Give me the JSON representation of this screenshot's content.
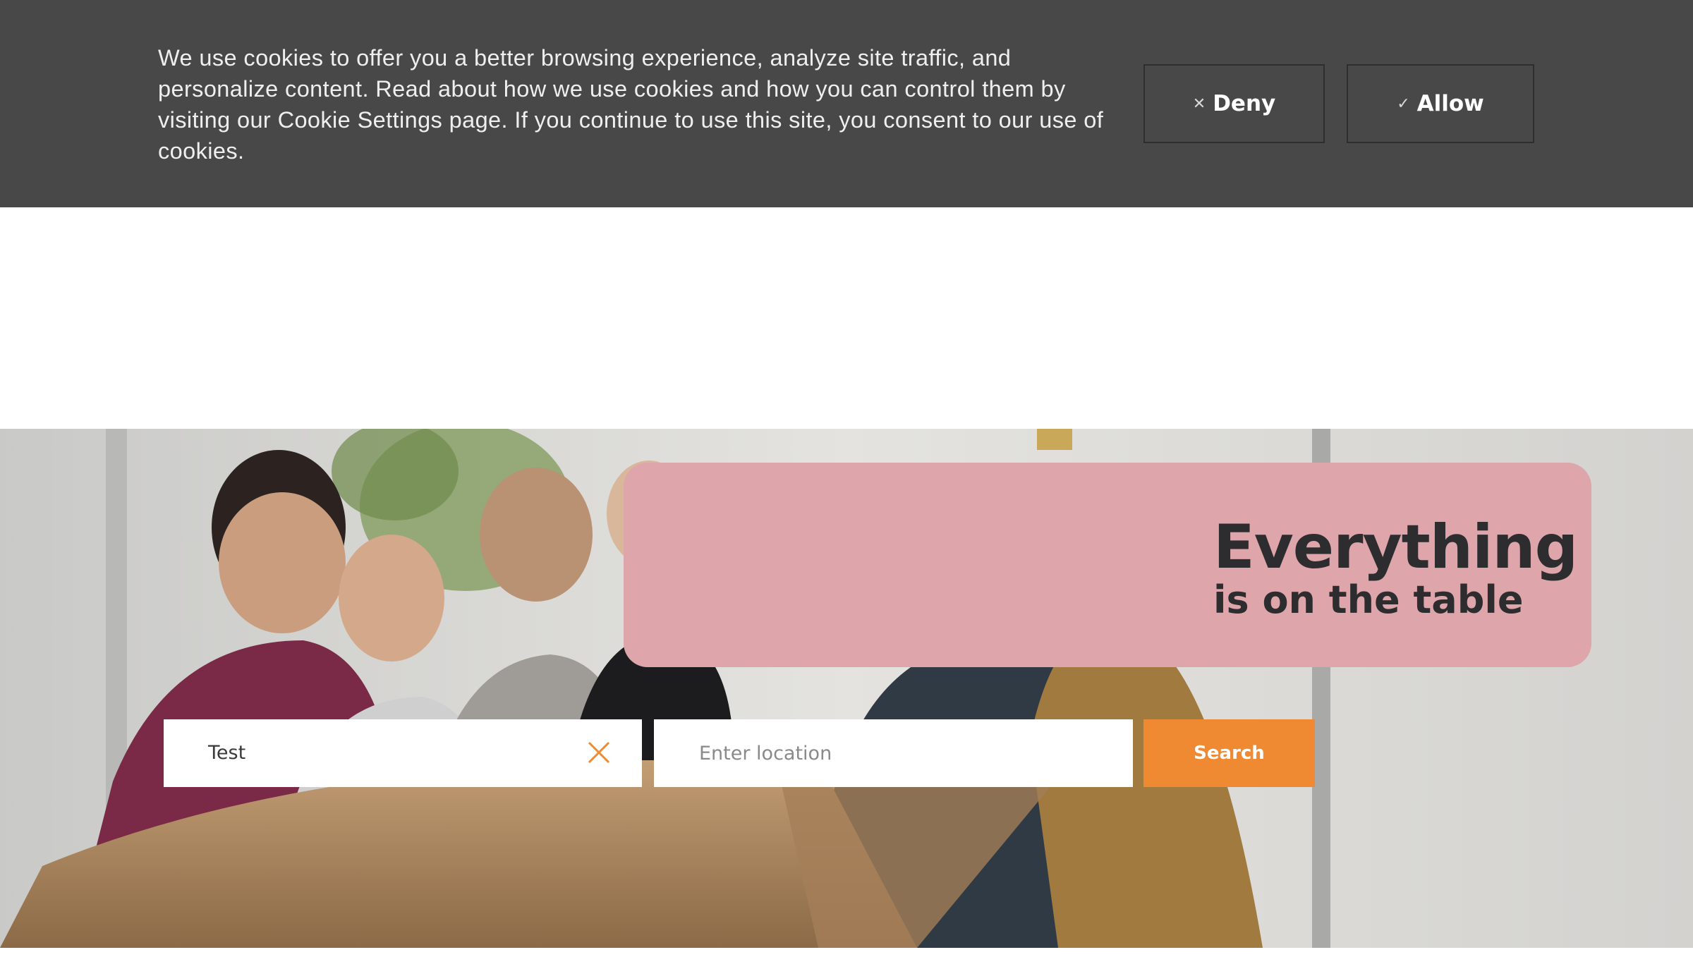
{
  "cookie_banner": {
    "message": "We use cookies to offer you a better browsing experience, analyze site traffic, and personalize content. Read about how we use cookies and how you can control them by visiting our Cookie Settings page. If you continue to use this site, you consent to our use of cookies.",
    "deny": {
      "icon": "close-icon",
      "label": "Deny"
    },
    "allow": {
      "icon": "check-icon",
      "label": "Allow"
    }
  },
  "hero": {
    "headline": "Everything",
    "subheadline": "is on the table",
    "search": {
      "job_value": "Test",
      "clear_icon": "close-icon",
      "location_placeholder": "Enter location",
      "button_label": "Search"
    }
  },
  "colors": {
    "banner_bg": "#484848",
    "promo_pink": "#dea5ab",
    "accent_orange": "#ef8a32",
    "headline_text": "#2d2d30"
  }
}
